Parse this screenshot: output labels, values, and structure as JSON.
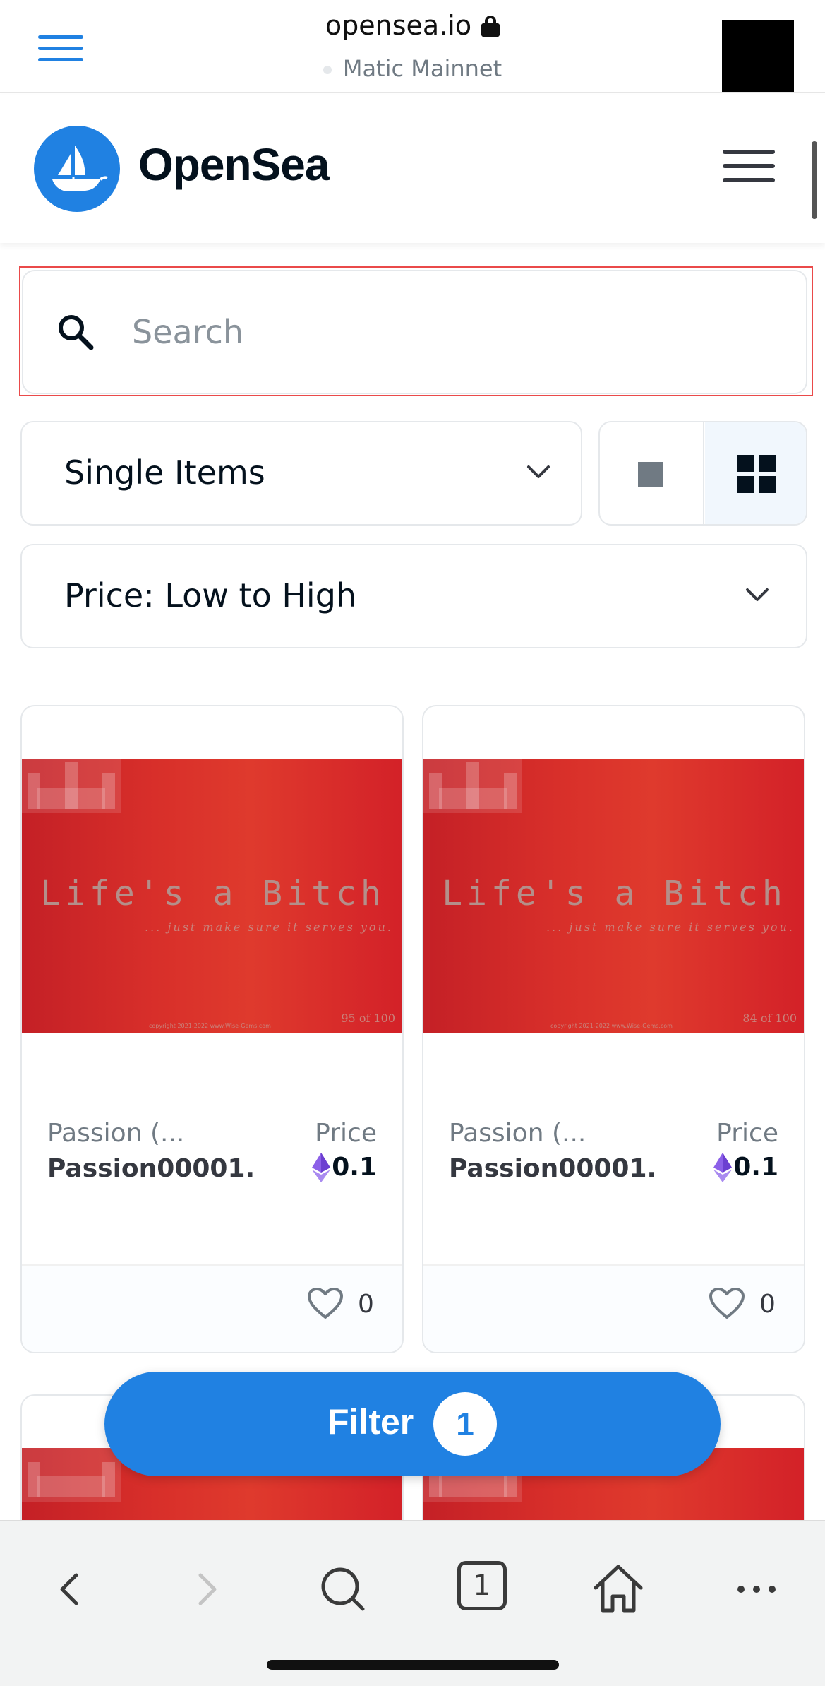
{
  "browser": {
    "url": "opensea.io",
    "network": "Matic Mainnet",
    "icons": [
      "menu-icon",
      "lock-icon"
    ]
  },
  "header": {
    "brand": "OpenSea",
    "icons": [
      "opensea-logo-icon",
      "hamburger-menu-icon"
    ]
  },
  "search": {
    "placeholder": "Search",
    "value": ""
  },
  "filters": {
    "item_type": "Single Items",
    "sort": "Price: Low to High",
    "view_mode": "grid"
  },
  "cards": [
    {
      "collection": "Passion (...",
      "name": "Passion00001.",
      "price_label": "Price",
      "price": "0.1",
      "likes": "0",
      "image": {
        "title": "Life's a Bitch",
        "subtitle": "... just make sure it serves you.",
        "edition": "95 of 100",
        "copyright": "copyright 2021-2022 www.Wise-Gems.com"
      }
    },
    {
      "collection": "Passion (...",
      "name": "Passion00001.",
      "price_label": "Price",
      "price": "0.1",
      "likes": "0",
      "image": {
        "title": "Life's a Bitch",
        "subtitle": "... just make sure it serves you.",
        "edition": "84 of 100",
        "copyright": "copyright 2021-2022 www.Wise-Gems.com"
      }
    }
  ],
  "filter_button": {
    "label": "Filter",
    "count": "1"
  },
  "bottom_bar": {
    "tab_count": "1",
    "icons": [
      "back-icon",
      "forward-icon",
      "search-icon",
      "tabs-icon",
      "home-icon",
      "more-icon"
    ]
  },
  "colors": {
    "accent": "#2081e2",
    "text": "#04111d",
    "muted": "#707a83",
    "border": "#e5e8eb",
    "eth": "#8c60e8"
  }
}
